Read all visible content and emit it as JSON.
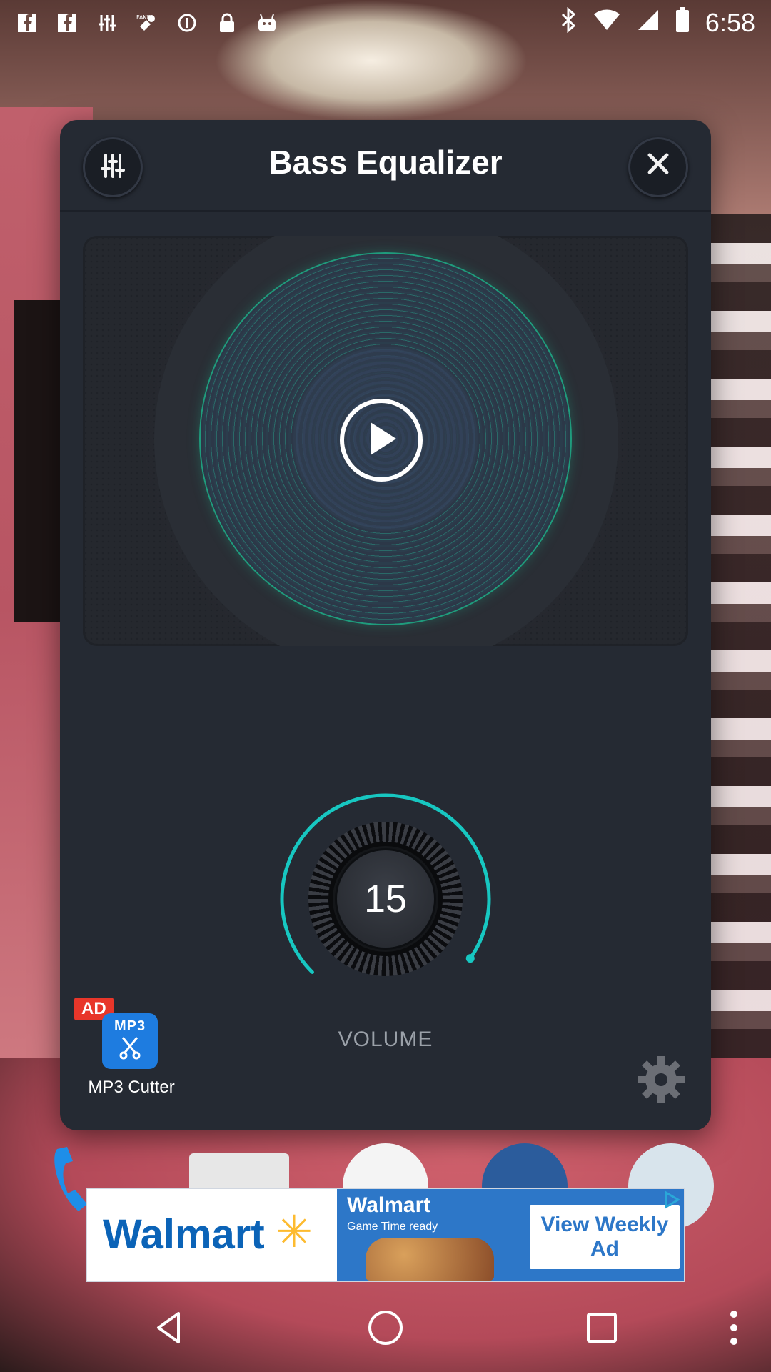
{
  "status_bar": {
    "time": "6:58",
    "left_icons": [
      "facebook-icon",
      "facebook-icon",
      "equalizer-icon",
      "fake-gps-icon",
      "info-icon",
      "lock-icon",
      "android-icon"
    ],
    "right_icons": [
      "bluetooth-icon",
      "wifi-icon",
      "signal-icon",
      "battery-icon"
    ]
  },
  "dialog": {
    "title": "Bass Equalizer",
    "eq_button_icon": "sliders-icon",
    "close_button_icon": "close-icon",
    "play_button_icon": "play-icon",
    "volume": {
      "value": "15",
      "label": "VOLUME",
      "level": 0.15
    },
    "ad_app": {
      "badge": "AD",
      "icon_text": "MP3",
      "label": "MP3 Cutter"
    },
    "settings_icon": "gear-icon"
  },
  "ad_banner": {
    "brand": "Walmart",
    "mid_title": "Walmart",
    "mid_sub": "Game Time ready",
    "cta": "View Weekly Ad"
  },
  "nav_bar": {
    "buttons": [
      "back-icon",
      "home-icon",
      "recents-icon",
      "more-icon"
    ]
  },
  "colors": {
    "dialog_bg": "#252a33",
    "accent": "#17c7c1",
    "ad_red": "#e8362a",
    "walmart_blue": "#0b63b7"
  }
}
